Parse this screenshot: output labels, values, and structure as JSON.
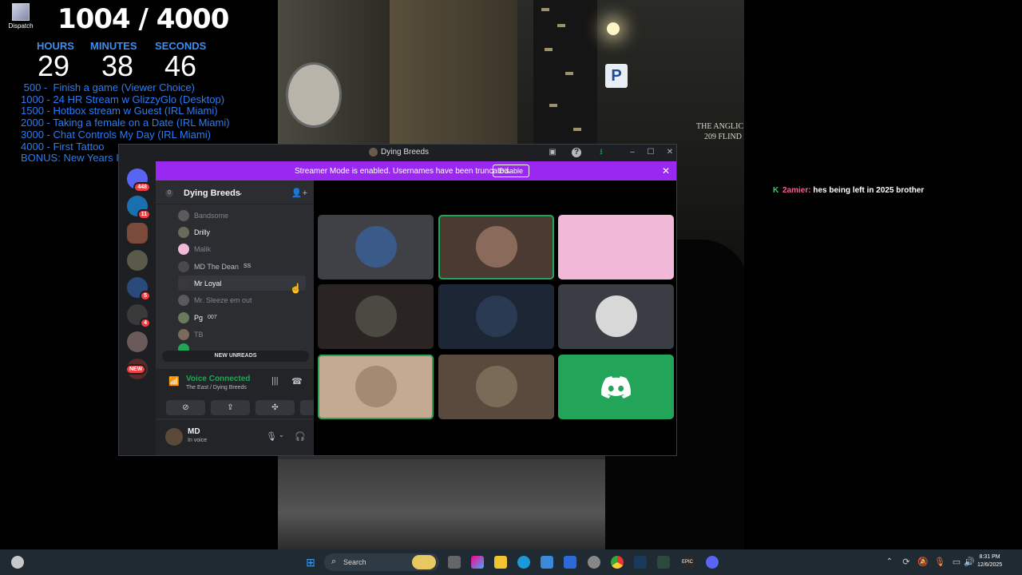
{
  "overlay": {
    "dispatch_label": "Dispatch",
    "goal_count": "1004 / 4000",
    "timer": {
      "hours_label": "HOURS",
      "hours": "29",
      "minutes_label": "MINUTES",
      "minutes": "38",
      "seconds_label": "SECONDS",
      "seconds": "46"
    },
    "goals": [
      " 500 -  Finish a game (Viewer Choice)",
      "1000 - 24 HR Stream w GlizzyGlo (Desktop)",
      "1500 - Hotbox stream w Guest (IRL Miami)",
      "2000 - Taking a female on a Date (IRL Miami)",
      "3000 - Chat Controls My Day (IRL Miami)",
      "4000 - First Tattoo",
      "BONUS: New Years In New York!"
    ]
  },
  "irl": {
    "sign_text_1": "THE ANGLIC",
    "sign_text_2": "209 FLIND",
    "parking": "P"
  },
  "chat": {
    "user": "2amier:",
    "message": "hes being left in 2025 brother"
  },
  "discord": {
    "window_title": "Dying Breeds",
    "streamer_msg": "Streamer Mode is enabled. Usernames have been truncated.",
    "disable_label": "Disable",
    "guild_badges": [
      "448",
      "11",
      "5",
      "4",
      "NEW"
    ],
    "server_name": "Dying Breeds",
    "server_badge": "0",
    "members": [
      {
        "name": "Bandsome",
        "extra": ""
      },
      {
        "name": "Drilly",
        "extra": ""
      },
      {
        "name": "Malik",
        "extra": ""
      },
      {
        "name": "MD The Dean",
        "extra": "SS"
      },
      {
        "name": "Mr Loyal",
        "extra": ""
      },
      {
        "name": "Mr. Sleeze em out",
        "extra": ""
      },
      {
        "name": "Pg",
        "extra": "007"
      },
      {
        "name": "TB",
        "extra": ""
      }
    ],
    "new_unreads": "NEW UNREADS",
    "voice_status": "Voice Connected",
    "voice_channel": "The East / Dying Breeds",
    "user_name": "MD",
    "user_status": "In voice"
  },
  "taskbar": {
    "search_label": "Search",
    "time": "8:31 PM",
    "date": "12/6/2025"
  },
  "colors": {
    "accent_purple": "#9b28f0",
    "voice_green": "#23a559",
    "goal_blue": "#2c7cf4"
  }
}
